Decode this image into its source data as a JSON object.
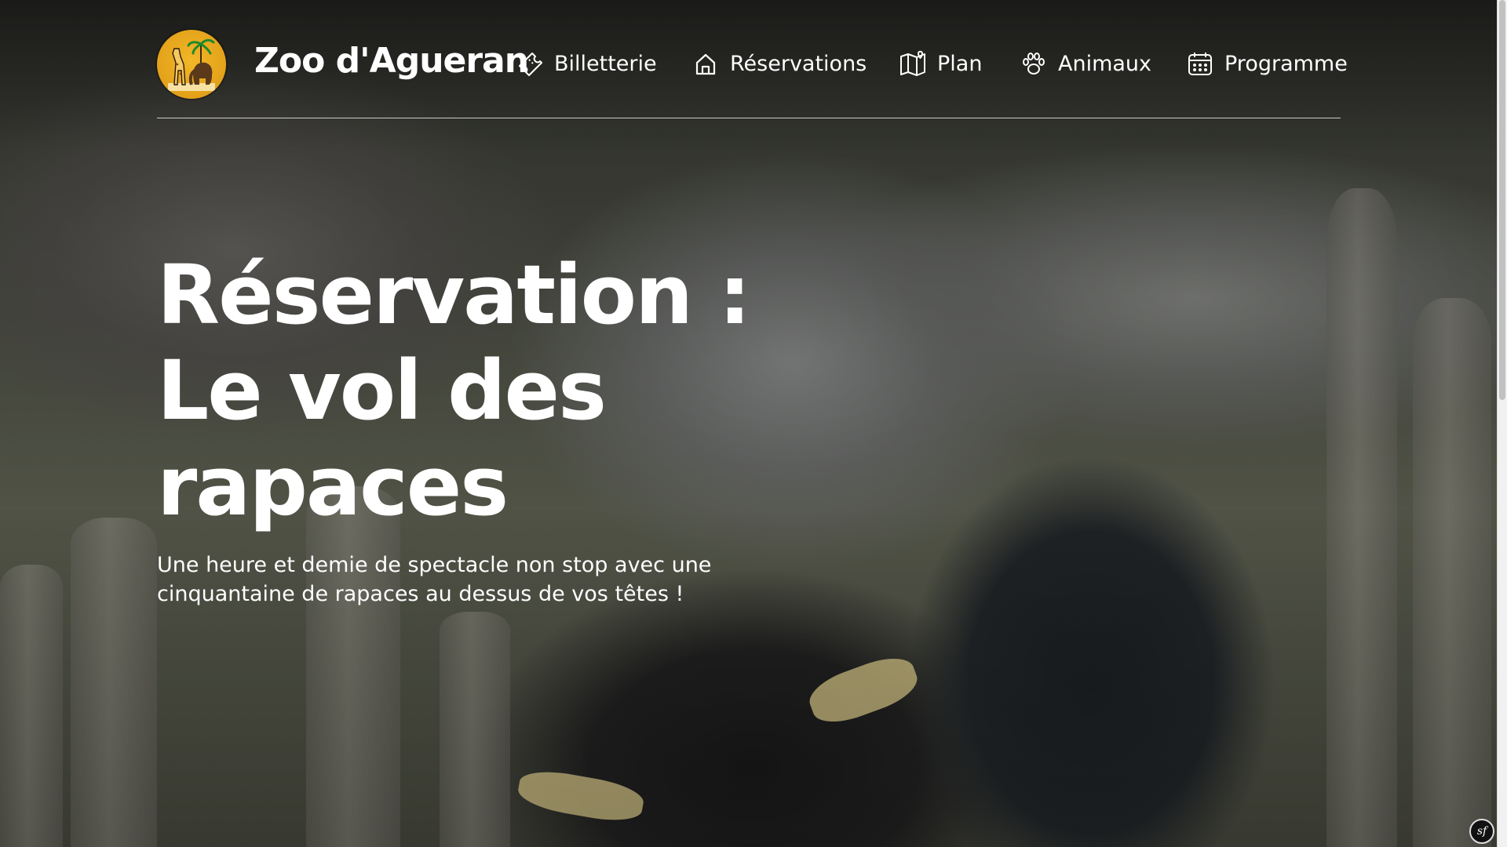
{
  "brand": {
    "name": "Zoo d'Agueran",
    "logo_icon": "giraffe-elephant-logo"
  },
  "nav": [
    {
      "label": "Billetterie",
      "icon": "ticket-icon"
    },
    {
      "label": "Réservations",
      "icon": "home-icon"
    },
    {
      "label": "Plan",
      "icon": "map-icon"
    },
    {
      "label": "Animaux",
      "icon": "paw-icon"
    },
    {
      "label": "Programme",
      "icon": "calendar-icon"
    }
  ],
  "hero": {
    "title_lines": [
      "Réservation :",
      "Le vol des",
      "rapaces"
    ],
    "subtitle_lines": [
      "Une heure et demie de spectacle non stop avec une",
      "cinquantaine de rapaces au dessus de vos têtes !"
    ]
  },
  "debug_toolbar": {
    "badge_text": "sf",
    "icon": "symfony-icon"
  },
  "colors": {
    "text": "#ffffff",
    "logo_yellow": "#f2b728",
    "divider": "#ffffff"
  }
}
